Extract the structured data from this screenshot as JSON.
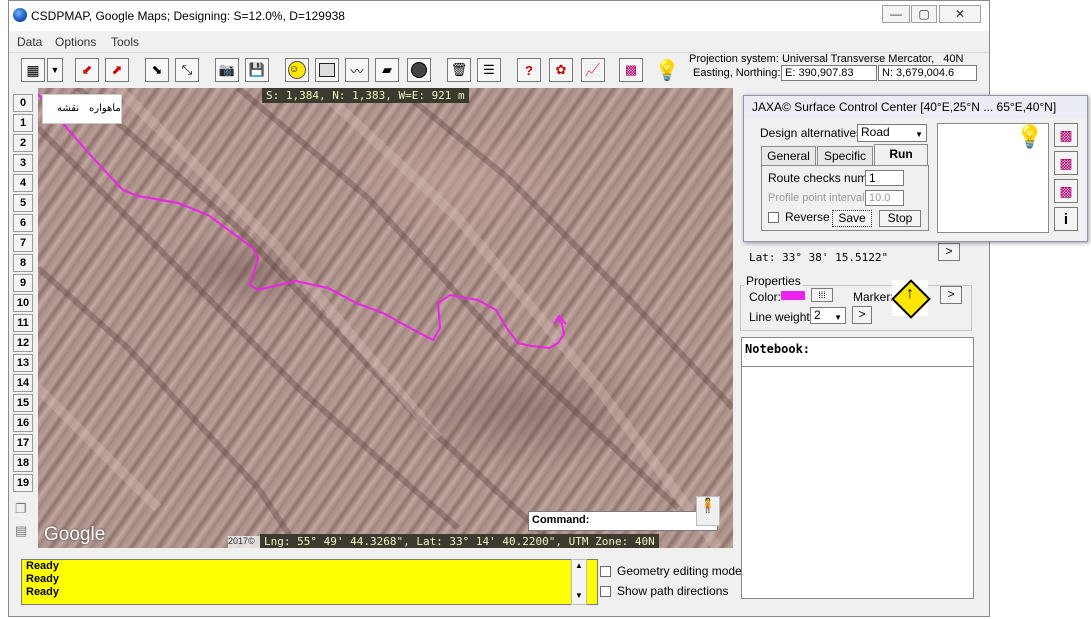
{
  "window": {
    "title": "CSDPMAP, Google Maps; Designing:  S=12.0%, D=129938",
    "minimize": "—",
    "maximize": "▢",
    "close": "✕"
  },
  "menu": [
    "Data",
    "Options",
    "Tools"
  ],
  "projection": {
    "label": "Projection system:",
    "system": "Universal Transverse Mercator,",
    "zone": "40N",
    "en_label": "Easting, Northing:",
    "easting": "E: 390,907.83",
    "northing": "N: 3,679,004.6"
  },
  "rows": [
    "0",
    "1",
    "2",
    "3",
    "4",
    "5",
    "6",
    "7",
    "8",
    "9",
    "10",
    "11",
    "12",
    "13",
    "14",
    "15",
    "16",
    "17",
    "18",
    "19"
  ],
  "map": {
    "legend_satellite": "ماهواره",
    "legend_map": "نقشه",
    "scale_text": "S: 1,384, N: 1,383, W=E: 921 m",
    "google": "Google",
    "copyright": "2017©",
    "coords": "Lng: 55° 49' 44.3268\", Lat: 33° 14' 40.2200\", UTM Zone: 40N",
    "command_label": "Command:",
    "route_color": "#ee22ee"
  },
  "status": {
    "lines": [
      "Ready",
      "Ready",
      "Ready"
    ],
    "geometry_mode": "Geometry editing mode",
    "show_path": "Show path directions"
  },
  "right": {
    "lat_text": "Lat:  33° 38' 15.5122\"",
    "go": ">",
    "properties": "Properties",
    "color_label": "Color:",
    "color_value": "#ee22ee",
    "ellipsis": "⁞⁞⁞",
    "marker_label": "Marker:",
    "marker_go": ">",
    "lineweight_label": "Line weight:",
    "lineweight": "2",
    "lw_go": ">",
    "notebook": "Notebook:"
  },
  "dialog": {
    "title": "JAXA© Surface Control Center [40°E,25°N ... 65°E,40°N]",
    "design_label": "Design alternatives:",
    "design_value": "Road",
    "tabs": [
      "General",
      "Specific",
      "Run"
    ],
    "route_checks_label": "Route checks num:",
    "route_checks": "1",
    "profile_label": "Profile point interval:",
    "profile": "10.0",
    "reverse": "Reverse",
    "save": "Save",
    "stop": "Stop",
    "info": "i"
  }
}
